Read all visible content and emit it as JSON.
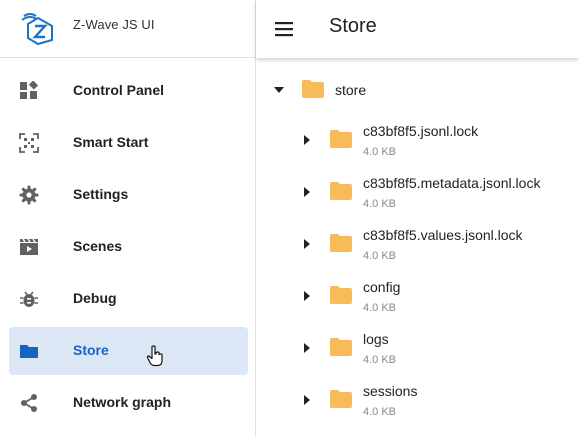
{
  "app": {
    "title": "Z-Wave JS UI"
  },
  "sidebar": {
    "items": [
      {
        "label": "Control Panel",
        "icon": "dashboard-icon",
        "active": false
      },
      {
        "label": "Smart Start",
        "icon": "qr-code-icon",
        "active": false
      },
      {
        "label": "Settings",
        "icon": "gear-icon",
        "active": false
      },
      {
        "label": "Scenes",
        "icon": "movie-clapper-icon",
        "active": false
      },
      {
        "label": "Debug",
        "icon": "bug-icon",
        "active": false
      },
      {
        "label": "Store",
        "icon": "folder-icon",
        "active": true
      },
      {
        "label": "Network graph",
        "icon": "share-icon",
        "active": false
      }
    ]
  },
  "topbar": {
    "title": "Store"
  },
  "tree": {
    "root": {
      "name": "store",
      "expanded": true
    },
    "children": [
      {
        "name": "c83bf8f5.jsonl.lock",
        "size": "4.0 KB"
      },
      {
        "name": "c83bf8f5.metadata.jsonl.lock",
        "size": "4.0 KB"
      },
      {
        "name": "c83bf8f5.values.jsonl.lock",
        "size": "4.0 KB"
      },
      {
        "name": "config",
        "size": "4.0 KB"
      },
      {
        "name": "logs",
        "size": "4.0 KB"
      },
      {
        "name": "sessions",
        "size": "4.0 KB"
      }
    ]
  },
  "colors": {
    "accent": "#1565c0",
    "active_bg": "#dbe7f5",
    "folder": "#f8bb5a",
    "icon_gray": "#616161"
  }
}
